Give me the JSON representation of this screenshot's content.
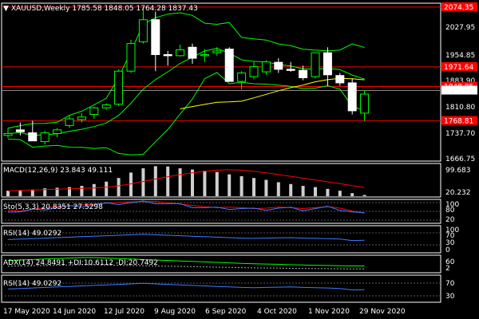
{
  "header": {
    "arrow": "▼",
    "title": "XAUUSD,Weekly  1785.58 1848.05 1764.28 1837.43"
  },
  "price_axis": {
    "ticks": [
      "2027.95",
      "1954.85",
      "1883.90",
      "1810.80",
      "1737.70",
      "1666.75"
    ],
    "highlight_labels": [
      {
        "text": "2074.35",
        "bg": "#ff0000",
        "value": 2074.35
      },
      {
        "text": "1971.64",
        "bg": "#ff0000",
        "value": 1911.4
      },
      {
        "text": "1848.85",
        "bg": "#ff0000",
        "value": 1858.0
      },
      {
        "text": "1837.43",
        "bg": "#ffffff",
        "fg": "#000000",
        "value": 1847.2
      },
      {
        "text": "1768.81",
        "bg": "#ff0000",
        "value": 1764.5
      }
    ]
  },
  "time_axis": {
    "labels": [
      "17 May 2020",
      "14 Jun 2020",
      "12 Jul 2020",
      "9 Aug 2020",
      "6 Sep 2020",
      "4 Oct 2020",
      "1 Nov 2020",
      "29 Nov 2020"
    ]
  },
  "colors": {
    "background": "#000000",
    "up_candle": "#00ff00",
    "down_candle": "#ffffff",
    "bollinger": "#00ff00",
    "ma_yellow": "#ffff00",
    "red_line": "#ff0000",
    "blue_line": "#3b7dff",
    "grid": "#5a5a5a"
  },
  "panels": {
    "macd": {
      "label": "MACD(12,26,9) 23.843 49.111",
      "ticks": [
        "99.683",
        "20.232"
      ]
    },
    "stoch": {
      "label": "Sto(5,3,3) 20.8351 27.5298",
      "ticks": [
        "100",
        "80",
        "20"
      ]
    },
    "rsi1": {
      "label": "RSI(14) 49.0292",
      "ticks": [
        "100",
        "70",
        "30",
        "0"
      ]
    },
    "adx": {
      "label": "ADX(14) 24.8491 +DI:10.6112 -DI:20.7492",
      "ticks": [
        "60",
        "2"
      ]
    },
    "rsi2": {
      "label": "RSI(14) 49.0292",
      "ticks": [
        "70",
        "30"
      ]
    }
  },
  "chart_data": {
    "type": "candlestick",
    "title": "XAUUSD,Weekly",
    "ylim": [
      1655,
      2085
    ],
    "horizontal_levels": [
      2074.35,
      1911.4,
      1858.0,
      1764.5
    ],
    "candles": [
      {
        "o": 1725.0,
        "h": 1745.0,
        "l": 1718.0,
        "c": 1730.0
      },
      {
        "o": 1740.0,
        "h": 1760.0,
        "l": 1725.0,
        "c": 1735.0
      },
      {
        "o": 1732.0,
        "h": 1765.0,
        "l": 1715.0,
        "c": 1710.0
      },
      {
        "o": 1708.0,
        "h": 1738.0,
        "l": 1700.0,
        "c": 1732.0
      },
      {
        "o": 1730.0,
        "h": 1745.0,
        "l": 1720.0,
        "c": 1740.0
      },
      {
        "o": 1752.0,
        "h": 1778.0,
        "l": 1745.0,
        "c": 1770.0
      },
      {
        "o": 1768.0,
        "h": 1785.0,
        "l": 1760.0,
        "c": 1775.0
      },
      {
        "o": 1782.0,
        "h": 1803.0,
        "l": 1770.0,
        "c": 1800.0
      },
      {
        "o": 1800.0,
        "h": 1812.0,
        "l": 1795.0,
        "c": 1808.0
      },
      {
        "o": 1810.0,
        "h": 1905.0,
        "l": 1805.0,
        "c": 1900.0
      },
      {
        "o": 1900.0,
        "h": 1985.0,
        "l": 1895.0,
        "c": 1975.0
      },
      {
        "o": 1980.0,
        "h": 2074.0,
        "l": 1975.0,
        "c": 2040.0
      },
      {
        "o": 2040.0,
        "h": 2062.0,
        "l": 1900.0,
        "c": 1945.0
      },
      {
        "o": 1945.0,
        "h": 1955.0,
        "l": 1915.0,
        "c": 1942.0
      },
      {
        "o": 1942.0,
        "h": 1972.0,
        "l": 1940.0,
        "c": 1958.0
      },
      {
        "o": 1965.0,
        "h": 1975.0,
        "l": 1920.0,
        "c": 1935.0
      },
      {
        "o": 1942.0,
        "h": 1960.0,
        "l": 1925.0,
        "c": 1945.0
      },
      {
        "o": 1950.0,
        "h": 1965.0,
        "l": 1942.0,
        "c": 1955.0
      },
      {
        "o": 1960.0,
        "h": 1965.0,
        "l": 1900.0,
        "c": 1872.0
      },
      {
        "o": 1872.0,
        "h": 1900.0,
        "l": 1850.0,
        "c": 1895.0
      },
      {
        "o": 1885.0,
        "h": 1925.0,
        "l": 1878.0,
        "c": 1912.0
      },
      {
        "o": 1898.0,
        "h": 1930.0,
        "l": 1890.0,
        "c": 1925.0
      },
      {
        "o": 1924.0,
        "h": 1935.0,
        "l": 1895.0,
        "c": 1905.0
      },
      {
        "o": 1905.0,
        "h": 1925.0,
        "l": 1898.0,
        "c": 1902.0
      },
      {
        "o": 1902.0,
        "h": 1915.0,
        "l": 1875.0,
        "c": 1882.0
      },
      {
        "o": 1885.0,
        "h": 1950.0,
        "l": 1880.0,
        "c": 1950.0
      },
      {
        "o": 1950.0,
        "h": 1965.0,
        "l": 1860.0,
        "c": 1890.0
      },
      {
        "o": 1888.0,
        "h": 1895.0,
        "l": 1860.0,
        "c": 1868.0
      },
      {
        "o": 1868.0,
        "h": 1880.0,
        "l": 1782.0,
        "c": 1792.0
      },
      {
        "o": 1785.6,
        "h": 1848.0,
        "l": 1764.3,
        "c": 1837.4
      }
    ]
  }
}
